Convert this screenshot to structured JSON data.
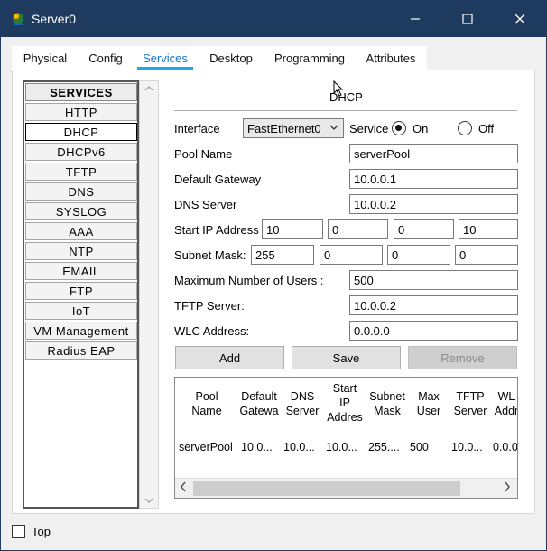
{
  "window": {
    "title": "Server0"
  },
  "tabs": [
    {
      "label": "Physical"
    },
    {
      "label": "Config"
    },
    {
      "label": "Services"
    },
    {
      "label": "Desktop"
    },
    {
      "label": "Programming"
    },
    {
      "label": "Attributes"
    }
  ],
  "active_tab": "Services",
  "sidebar": {
    "header": "SERVICES",
    "items": [
      "HTTP",
      "DHCP",
      "DHCPv6",
      "TFTP",
      "DNS",
      "SYSLOG",
      "AAA",
      "NTP",
      "EMAIL",
      "FTP",
      "IoT",
      "VM Management",
      "Radius EAP"
    ],
    "active": "DHCP"
  },
  "dhcp": {
    "title": "DHCP",
    "interface_label": "Interface",
    "interface_value": "FastEthernet0",
    "service_label": "Service",
    "on_label": "On",
    "off_label": "Off",
    "service_on": true,
    "pool_name_label": "Pool Name",
    "pool_name": "serverPool",
    "gateway_label": "Default Gateway",
    "gateway": "10.0.0.1",
    "dns_label": "DNS Server",
    "dns": "10.0.0.2",
    "start_ip_label": "Start IP Address",
    "start_ip": [
      "10",
      "0",
      "0",
      "10"
    ],
    "mask_label": "Subnet Mask:",
    "mask": [
      "255",
      "0",
      "0",
      "0"
    ],
    "max_users_label": "Maximum Number of Users :",
    "max_users": "500",
    "tftp_label": "TFTP Server:",
    "tftp": "10.0.0.2",
    "wlc_label": "WLC Address:",
    "wlc": "0.0.0.0",
    "add_label": "Add",
    "save_label": "Save",
    "remove_label": "Remove"
  },
  "table": {
    "headers": [
      "Pool\nName",
      "Default\nGatewa",
      "DNS\nServer",
      "Start\nIP\nAddres",
      "Subnet\nMask",
      "Max\nUser",
      "TFTP\nServer",
      "WL\nAddr"
    ],
    "row": [
      "serverPool",
      "10.0...",
      "10.0...",
      "10.0...",
      "255....",
      "500",
      "10.0...",
      "0.0.0"
    ]
  },
  "footer": {
    "top_label": "Top",
    "top_checked": false
  }
}
